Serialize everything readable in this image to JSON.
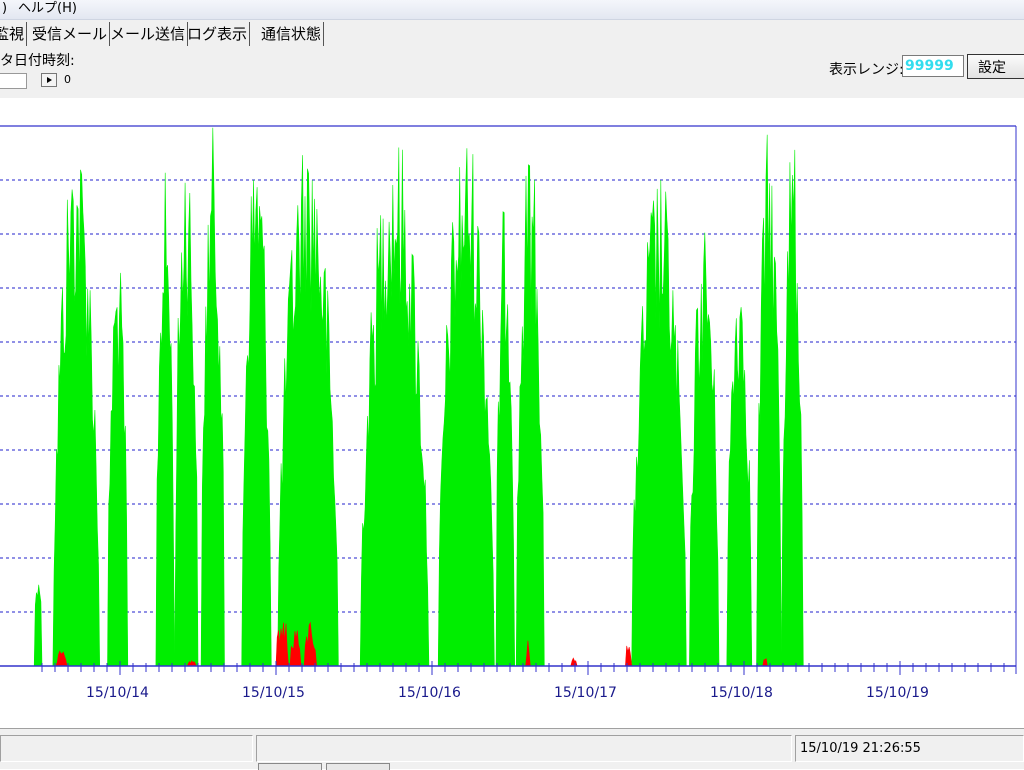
{
  "menubar": {
    "items": [
      ")",
      "ヘルプ(H)"
    ]
  },
  "tabs": [
    "監視",
    "受信メール",
    "メール送信",
    "ログ表示",
    "通信状態"
  ],
  "controls": {
    "date_label": "タ日付時刻:",
    "slider_value": "0",
    "range_label": "表示レンジ:",
    "range_value": "99999",
    "set_label": "設定"
  },
  "chart_data": {
    "type": "area",
    "title": "",
    "xlabel": "",
    "ylabel": "",
    "x_tick_labels": [
      "15/10/14",
      "15/10/15",
      "15/10/16",
      "15/10/17",
      "15/10/18",
      "15/10/19"
    ],
    "x_tick_days": [
      14,
      15,
      16,
      17,
      18,
      19
    ],
    "x_range_days": [
      13.45,
      19.98
    ],
    "ylim": [
      0,
      100
    ],
    "grid": {
      "horizontal": true,
      "style": "dashed",
      "lines": 10
    },
    "colors": {
      "series1": "#00ee00",
      "series2": "#ff0000",
      "grid": "#2222cc",
      "axis": "#3333cc"
    },
    "series": [
      {
        "color": "#00ee00",
        "bursts": [
          {
            "start": 13.45,
            "end": 13.5,
            "peak": 20
          },
          {
            "start": 13.57,
            "end": 13.87,
            "peak": 100
          },
          {
            "start": 13.92,
            "end": 14.05,
            "peak": 78
          },
          {
            "start": 14.23,
            "end": 14.35,
            "peak": 92
          },
          {
            "start": 14.35,
            "end": 14.5,
            "peak": 100
          },
          {
            "start": 14.52,
            "end": 14.67,
            "peak": 100
          },
          {
            "start": 14.78,
            "end": 14.97,
            "peak": 100
          },
          {
            "start": 15.01,
            "end": 15.4,
            "peak": 100
          },
          {
            "start": 15.54,
            "end": 15.98,
            "peak": 100
          },
          {
            "start": 16.04,
            "end": 16.4,
            "peak": 100
          },
          {
            "start": 16.41,
            "end": 16.53,
            "peak": 88
          },
          {
            "start": 16.54,
            "end": 16.72,
            "peak": 98
          },
          {
            "start": 17.28,
            "end": 17.63,
            "peak": 92
          },
          {
            "start": 17.65,
            "end": 17.84,
            "peak": 83
          },
          {
            "start": 17.89,
            "end": 18.05,
            "peak": 78
          },
          {
            "start": 18.08,
            "end": 18.24,
            "peak": 100
          },
          {
            "start": 18.24,
            "end": 18.38,
            "peak": 100
          }
        ]
      },
      {
        "color": "#ff0000",
        "bursts": [
          {
            "start": 13.59,
            "end": 13.66,
            "peak": 3
          },
          {
            "start": 14.43,
            "end": 14.49,
            "peak": 1
          },
          {
            "start": 15.0,
            "end": 15.08,
            "peak": 11
          },
          {
            "start": 15.09,
            "end": 15.16,
            "peak": 8
          },
          {
            "start": 15.18,
            "end": 15.26,
            "peak": 9
          },
          {
            "start": 16.6,
            "end": 16.63,
            "peak": 5
          },
          {
            "start": 16.89,
            "end": 16.93,
            "peak": 2
          },
          {
            "start": 17.24,
            "end": 17.28,
            "peak": 6
          },
          {
            "start": 18.12,
            "end": 18.15,
            "peak": 3
          }
        ]
      }
    ]
  },
  "status": {
    "datetime": "15/10/19 21:26:55"
  }
}
